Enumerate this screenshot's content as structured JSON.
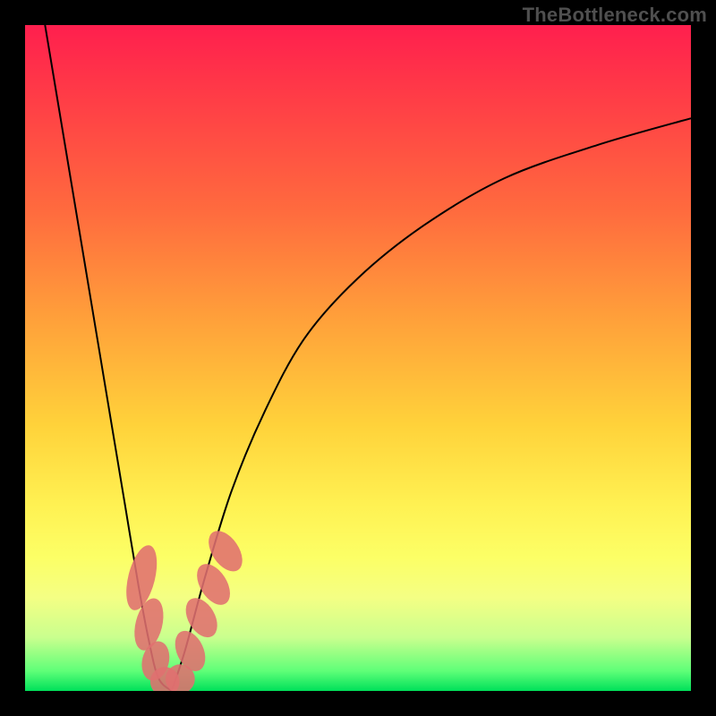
{
  "attribution": "TheBottleneck.com",
  "chart_data": {
    "type": "line",
    "title": "",
    "xlabel": "",
    "ylabel": "",
    "xlim": [
      0,
      100
    ],
    "ylim": [
      0,
      100
    ],
    "series": [
      {
        "name": "left-branch",
        "x": [
          3,
          5,
          7,
          9,
          11,
          13,
          15,
          17,
          18.5,
          20,
          22
        ],
        "values": [
          100,
          88,
          76,
          64,
          52,
          40,
          28,
          16,
          8,
          2,
          0
        ]
      },
      {
        "name": "right-branch",
        "x": [
          22,
          24,
          27,
          31,
          36,
          42,
          50,
          60,
          72,
          86,
          100
        ],
        "values": [
          0,
          6,
          17,
          30,
          42,
          53,
          62,
          70,
          77,
          82,
          86
        ]
      }
    ],
    "markers": [
      {
        "name": "left-blob-1",
        "x": 17.5,
        "y": 17,
        "rx": 2.0,
        "ry": 5.0,
        "rot": 14
      },
      {
        "name": "left-blob-2",
        "x": 18.6,
        "y": 10,
        "rx": 2.0,
        "ry": 4.0,
        "rot": 14
      },
      {
        "name": "left-blob-3",
        "x": 19.6,
        "y": 4.5,
        "rx": 2.0,
        "ry": 3.0,
        "rot": 14
      },
      {
        "name": "vertex-blob-1",
        "x": 21.0,
        "y": 1.4,
        "rx": 2.2,
        "ry": 2.2,
        "rot": 0
      },
      {
        "name": "vertex-blob-2",
        "x": 23.3,
        "y": 1.8,
        "rx": 2.2,
        "ry": 2.2,
        "rot": 0
      },
      {
        "name": "right-blob-1",
        "x": 24.8,
        "y": 6.0,
        "rx": 2.0,
        "ry": 3.2,
        "rot": -25
      },
      {
        "name": "right-blob-2",
        "x": 26.5,
        "y": 11.0,
        "rx": 2.0,
        "ry": 3.2,
        "rot": -30
      },
      {
        "name": "right-blob-3",
        "x": 28.3,
        "y": 16.0,
        "rx": 2.0,
        "ry": 3.4,
        "rot": -32
      },
      {
        "name": "right-blob-4",
        "x": 30.1,
        "y": 21.0,
        "rx": 2.0,
        "ry": 3.4,
        "rot": -34
      }
    ],
    "marker_color": "#e06f6f",
    "colors": {
      "background_top": "#ff1f4e",
      "background_bottom": "#00e05a",
      "curve": "#000000",
      "frame": "#000000"
    }
  }
}
